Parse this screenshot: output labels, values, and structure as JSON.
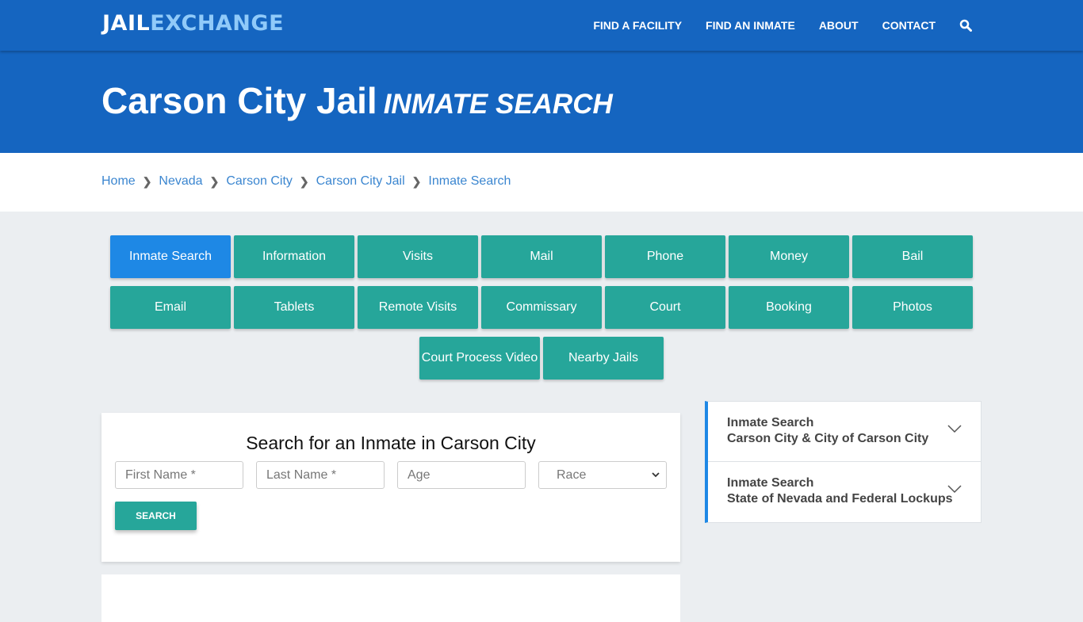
{
  "header": {
    "logo": {
      "part1": "JAIL",
      "part2": "EXCHANGE"
    },
    "nav": [
      "FIND A FACILITY",
      "FIND AN INMATE",
      "ABOUT",
      "CONTACT"
    ],
    "search_icon": "search-icon"
  },
  "hero": {
    "title": "Carson City Jail",
    "subtitle": "INMATE SEARCH"
  },
  "breadcrumb": [
    "Home",
    "Nevada",
    "Carson City",
    "Carson City Jail",
    "Inmate Search"
  ],
  "buttons": [
    "Inmate Search",
    "Information",
    "Visits",
    "Mail",
    "Phone",
    "Money",
    "Bail",
    "Email",
    "Tablets",
    "Remote Visits",
    "Commissary",
    "Court",
    "Booking",
    "Photos",
    "Court Process Video",
    "Nearby Jails"
  ],
  "active_button": "Inmate Search",
  "search_form": {
    "title": "Search for an Inmate in Carson City",
    "first_name_placeholder": "First Name *",
    "last_name_placeholder": "Last Name *",
    "age_placeholder": "Age",
    "race_selected": "Race",
    "submit_label": "SEARCH"
  },
  "sidebar": [
    {
      "line1": "Inmate Search",
      "line2": "Carson City & City of Carson City"
    },
    {
      "line1": "Inmate Search",
      "line2": "State of Nevada and Federal Lockups"
    }
  ],
  "colors": {
    "brand_blue": "#1565c0",
    "accent_teal": "#26a69a",
    "active_blue": "#1e88e5",
    "logo_light": "#90caf9"
  }
}
